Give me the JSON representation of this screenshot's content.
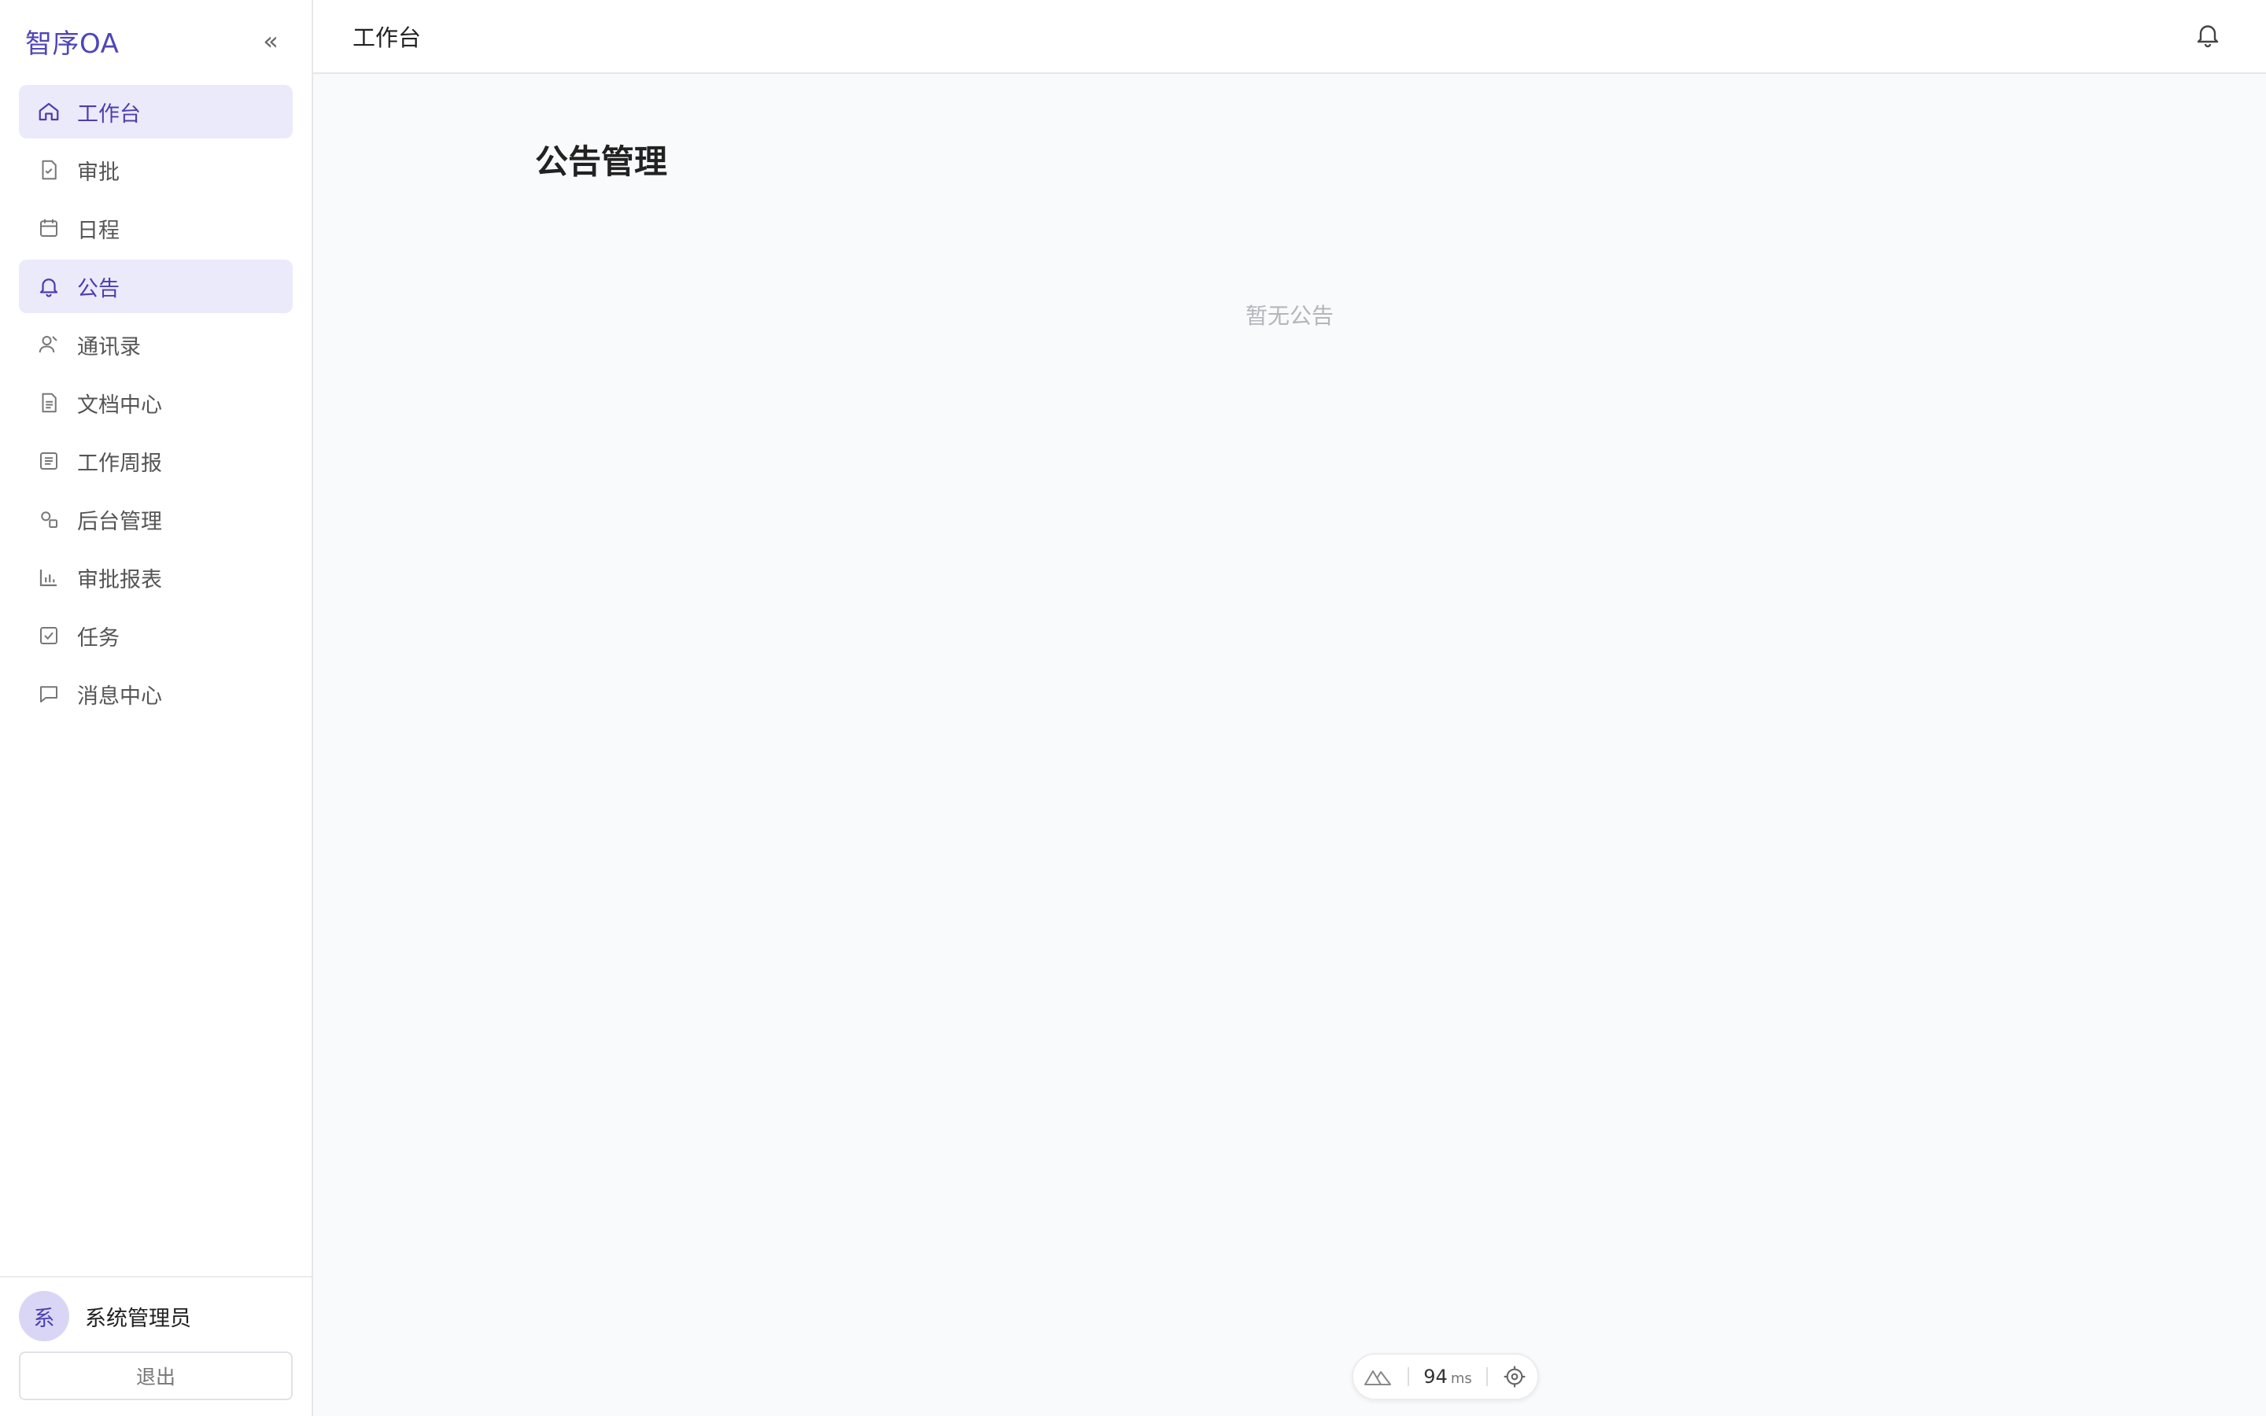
{
  "app": {
    "brand": "智序OA",
    "collapse_glyph": "«"
  },
  "sidebar": {
    "items": [
      {
        "label": "工作台",
        "icon": "home-icon",
        "active": true
      },
      {
        "label": "审批",
        "icon": "approval-doc-icon",
        "active": false
      },
      {
        "label": "日程",
        "icon": "calendar-icon",
        "active": false
      },
      {
        "label": "公告",
        "icon": "bell-icon",
        "active": true
      },
      {
        "label": "通讯录",
        "icon": "contacts-icon",
        "active": false
      },
      {
        "label": "文档中心",
        "icon": "document-icon",
        "active": false
      },
      {
        "label": "工作周报",
        "icon": "report-list-icon",
        "active": false
      },
      {
        "label": "后台管理",
        "icon": "admin-settings-icon",
        "active": false
      },
      {
        "label": "审批报表",
        "icon": "bar-chart-icon",
        "active": false
      },
      {
        "label": "任务",
        "icon": "task-check-icon",
        "active": false
      },
      {
        "label": "消息中心",
        "icon": "message-icon",
        "active": false
      }
    ]
  },
  "user": {
    "avatar_text": "系",
    "name": "系统管理员",
    "logout_label": "退出"
  },
  "header": {
    "title": "工作台",
    "bell_icon": "bell-icon"
  },
  "main": {
    "page_title": "公告管理",
    "empty_text": "暂无公告"
  },
  "devbar": {
    "time_value": "94",
    "time_unit": "ms"
  },
  "colors": {
    "accent": "#4b3fae",
    "active_bg": "#ebeafb",
    "avatar_bg": "#d9d6f5",
    "page_bg": "#f9fafb"
  }
}
